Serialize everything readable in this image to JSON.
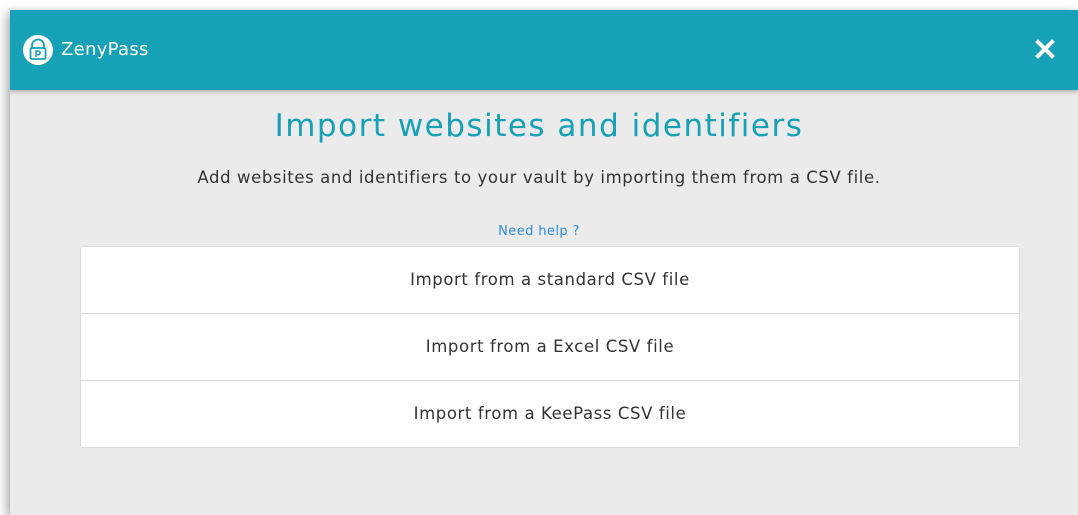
{
  "app": {
    "name": "ZenyPass",
    "logo_icon": "padlock-p-icon",
    "close_icon": "close-icon"
  },
  "colors": {
    "accent": "#16a1b7",
    "link": "#2f8fe0",
    "background": "#ebebeb",
    "text": "#333333"
  },
  "main": {
    "title": "Import websites and identifiers",
    "description": "Add websites and identifiers to your vault by importing them from a CSV file.",
    "help_link": "Need help ?",
    "options": [
      {
        "label": "Import from a standard CSV file"
      },
      {
        "label": "Import from a Excel CSV file"
      },
      {
        "label": "Import from a KeePass CSV file"
      }
    ]
  }
}
